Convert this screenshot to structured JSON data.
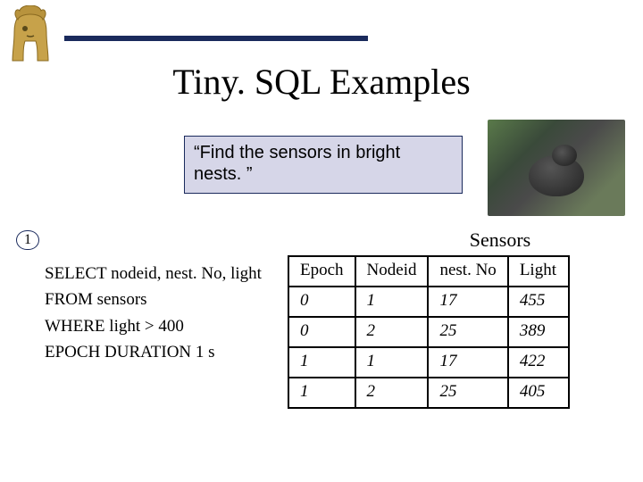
{
  "title": "Tiny. SQL Examples",
  "quote": "“Find the sensors in bright nests. ”",
  "example_number": "1",
  "query": {
    "line1": "SELECT nodeid, nest. No, light",
    "line2": "FROM sensors",
    "line3": "WHERE light > 400",
    "line4": "EPOCH DURATION 1 s"
  },
  "table": {
    "title": "Sensors",
    "headers": [
      "Epoch",
      "Nodeid",
      "nest. No",
      "Light"
    ],
    "rows": [
      [
        "0",
        "1",
        "17",
        "455"
      ],
      [
        "0",
        "2",
        "25",
        "389"
      ],
      [
        "1",
        "1",
        "17",
        "422"
      ],
      [
        "1",
        "2",
        "25",
        "405"
      ]
    ]
  },
  "chart_data": {
    "type": "table",
    "title": "Sensors",
    "columns": [
      "Epoch",
      "Nodeid",
      "nest.No",
      "Light"
    ],
    "rows": [
      {
        "Epoch": 0,
        "Nodeid": 1,
        "nest.No": 17,
        "Light": 455
      },
      {
        "Epoch": 0,
        "Nodeid": 2,
        "nest.No": 25,
        "Light": 389
      },
      {
        "Epoch": 1,
        "Nodeid": 1,
        "nest.No": 17,
        "Light": 422
      },
      {
        "Epoch": 1,
        "Nodeid": 2,
        "nest.No": 25,
        "Light": 405
      }
    ]
  }
}
